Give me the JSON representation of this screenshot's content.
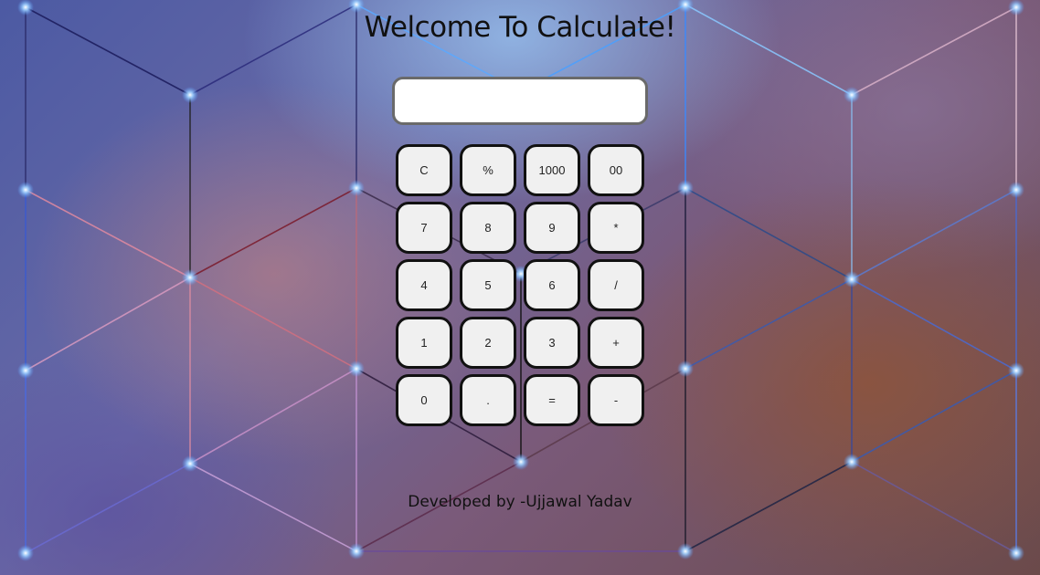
{
  "page": {
    "title": "Welcome To Calculate!",
    "footer": "Developed by -Ujjawal Yadav"
  },
  "display": {
    "value": "",
    "placeholder": ""
  },
  "keypad": {
    "rows": [
      [
        "C",
        "%",
        "1000",
        "00"
      ],
      [
        "7",
        "8",
        "9",
        "*"
      ],
      [
        "4",
        "5",
        "6",
        "/"
      ],
      [
        "1",
        "2",
        "3",
        "+"
      ],
      [
        "0",
        ".",
        "=",
        "-"
      ]
    ],
    "names": [
      [
        "clear",
        "percent",
        "thousand",
        "double-zero"
      ],
      [
        "seven",
        "eight",
        "nine",
        "multiply"
      ],
      [
        "four",
        "five",
        "six",
        "divide"
      ],
      [
        "one",
        "two",
        "three",
        "add"
      ],
      [
        "zero",
        "decimal",
        "equals",
        "subtract"
      ]
    ]
  },
  "colors": {
    "key_background": "#f0f0f0",
    "key_border": "#111111",
    "display_border": "#6a6a6a",
    "glow": "#9fd0ff"
  }
}
